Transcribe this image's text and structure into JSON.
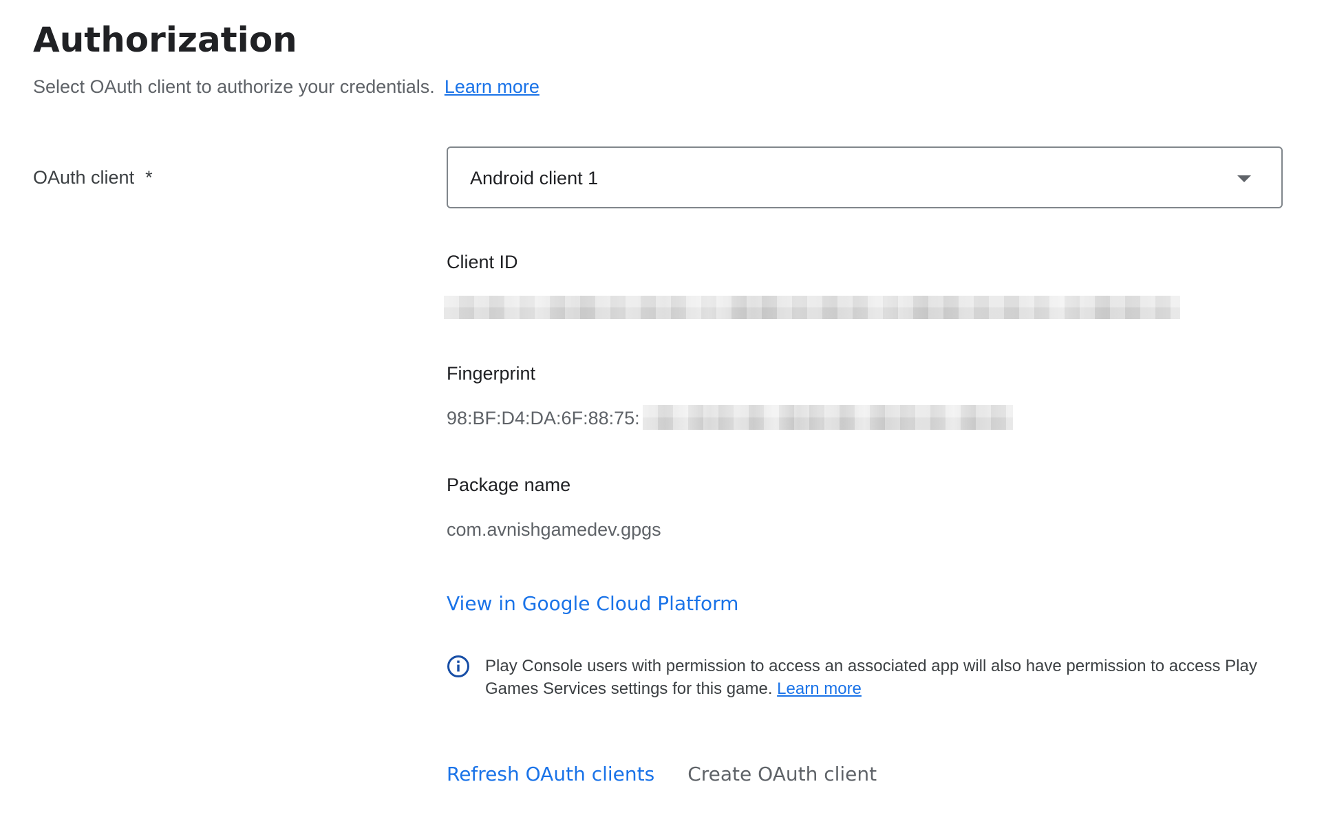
{
  "header": {
    "title": "Authorization",
    "subtitle": "Select OAuth client to authorize your credentials.",
    "learn_more": "Learn more"
  },
  "oauth": {
    "label": "OAuth client",
    "required_mark": "*",
    "selected": "Android client 1"
  },
  "details": {
    "client_id_label": "Client ID",
    "fingerprint_label": "Fingerprint",
    "fingerprint_value": "98:BF:D4:DA:6F:88:75:",
    "package_label": "Package name",
    "package_value": "com.avnishgamedev.gpgs"
  },
  "links": {
    "view_gcp": "View in Google Cloud Platform"
  },
  "info": {
    "text": "Play Console users with permission to access an associated app will also have permission to access Play Games Services settings for this game.",
    "learn_more": "Learn more"
  },
  "actions": {
    "refresh": "Refresh OAuth clients",
    "create": "Create OAuth client"
  },
  "colors": {
    "link": "#1a73e8",
    "text": "#3c4043",
    "muted": "#5f6368",
    "info_icon": "#174ea6"
  }
}
